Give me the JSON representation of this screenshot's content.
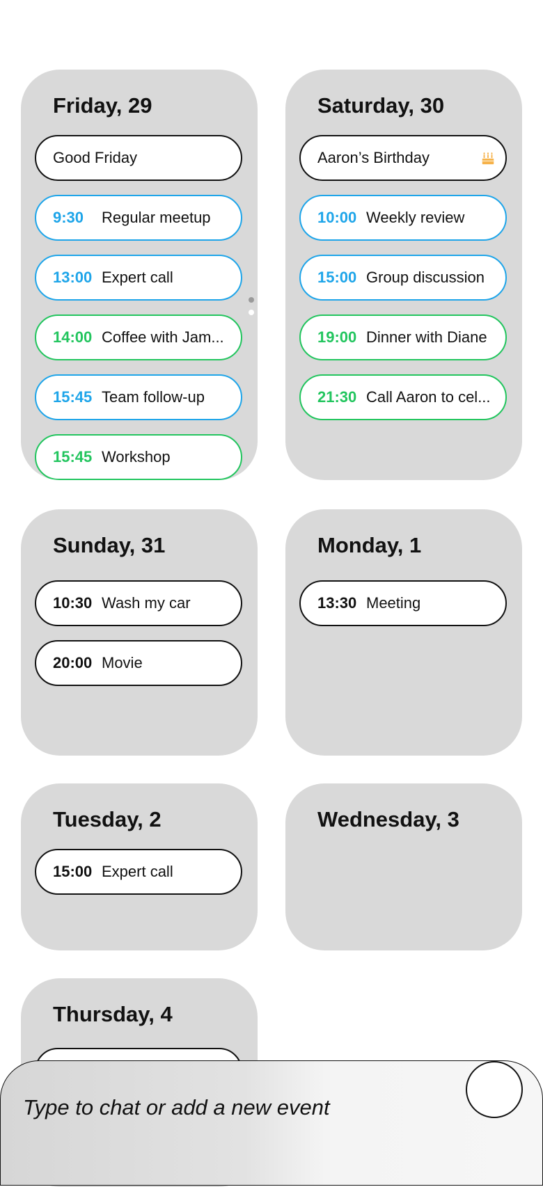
{
  "days": [
    {
      "title": "Friday, 29",
      "events": [
        {
          "type": "holiday",
          "title": "Good Friday"
        },
        {
          "time": "9:30",
          "title": "Regular meetup"
        },
        {
          "time": "13:00",
          "title": "Expert call"
        },
        {
          "time": "14:00",
          "title": "Coffee with Jam..."
        },
        {
          "time": "15:45",
          "title": "Team follow-up"
        },
        {
          "time": "15:45",
          "title": "Workshop"
        }
      ]
    },
    {
      "title": "Saturday, 30",
      "events": [
        {
          "type": "birthday",
          "title": "Aaron’s Birthday",
          "icon": "birthday-cake-icon"
        },
        {
          "time": "10:00",
          "title": "Weekly review"
        },
        {
          "time": "15:00",
          "title": "Group discussion"
        },
        {
          "time": "19:00",
          "title": "Dinner with Diane"
        },
        {
          "time": "21:30",
          "title": "Call Aaron to cel..."
        }
      ]
    },
    {
      "title": "Sunday, 31",
      "events": [
        {
          "time": "10:30",
          "title": "Wash my car"
        },
        {
          "time": "20:00",
          "title": "Movie"
        }
      ]
    },
    {
      "title": "Monday, 1",
      "events": [
        {
          "time": "13:30",
          "title": "Meeting"
        }
      ]
    },
    {
      "title": "Tuesday, 2",
      "events": [
        {
          "time": "15:00",
          "title": "Expert call"
        }
      ]
    },
    {
      "title": "Wednesday, 3",
      "events": []
    },
    {
      "title": "Thursday, 4",
      "events": []
    }
  ],
  "chat": {
    "placeholder": "Type to chat or add a new event",
    "mic_icon": "microphone-icon"
  },
  "colors": {
    "card": "#d9d9d9",
    "blue": "#1ea5e9",
    "green": "#22c55e",
    "cake": "#f6b24a"
  }
}
